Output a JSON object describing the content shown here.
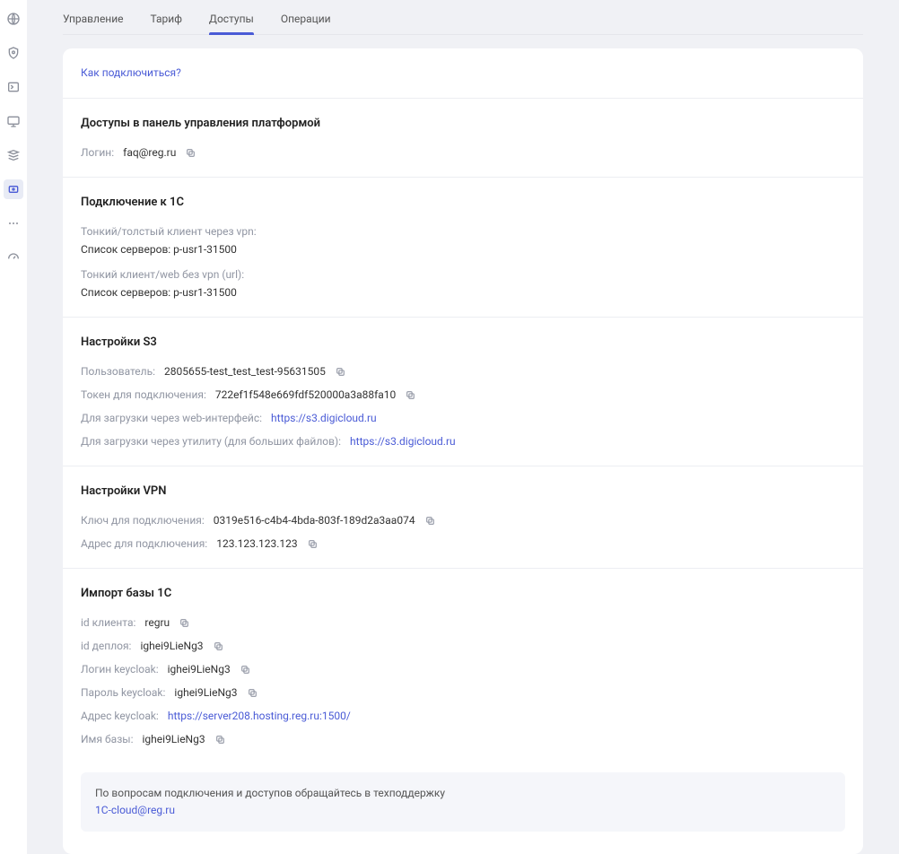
{
  "tabs": {
    "management": "Управление",
    "tariff": "Тариф",
    "accesses": "Доступы",
    "operations": "Операции"
  },
  "card": {
    "how_to_connect": "Как подключиться?",
    "panel_access": {
      "title": "Доступы в панель управления платформой",
      "login_label": "Логин:",
      "login_value": "faq@reg.ru"
    },
    "connect_1c": {
      "title": "Подключение к 1С",
      "thin_thick_via_vpn": "Тонкий/толстый клиент через vpn:",
      "server_list_1": "Список серверов: p-usr1-31500",
      "thin_web_no_vpn": "Тонкий клиент/web без vpn (url):",
      "server_list_2": "Список серверов: p-usr1-31500"
    },
    "s3": {
      "title": "Настройки S3",
      "user_label": "Пользователь:",
      "user_value": "2805655-test_test_test-95631505",
      "token_label": "Токен для подключения:",
      "token_value": "722ef1f548e669fdf520000a3a88fa10",
      "web_upload_label": "Для загрузки через web-интерфейс:",
      "web_upload_url": "https://s3.digicloud.ru",
      "util_upload_label": "Для загрузки через утилиту (для больших файлов):",
      "util_upload_url": "https://s3.digicloud.ru"
    },
    "vpn": {
      "title": "Настройки VPN",
      "key_label": "Ключ для подключения:",
      "key_value": "0319e516-c4b4-4bda-803f-189d2a3aa074",
      "address_label": "Адрес для подключения:",
      "address_value": "123.123.123.123"
    },
    "import_1c": {
      "title": "Импорт базы 1С",
      "client_id_label": "id клиента:",
      "client_id_value": "regru",
      "deploy_id_label": "id деплоя:",
      "deploy_id_value": "ighei9LieNg3",
      "kc_login_label": "Логин keycloak:",
      "kc_login_value": "ighei9LieNg3",
      "kc_pass_label": "Пароль keycloak:",
      "kc_pass_value": "ighei9LieNg3",
      "kc_addr_label": "Адрес keycloak:",
      "kc_addr_value": "https://server208.hosting.reg.ru:1500/",
      "db_name_label": "Имя базы:",
      "db_name_value": "ighei9LieNg3"
    },
    "info_box": {
      "text": "По вопросам подключения и доступов обращайтесь в техподдержку",
      "email": "1C-cloud@reg.ru"
    }
  }
}
